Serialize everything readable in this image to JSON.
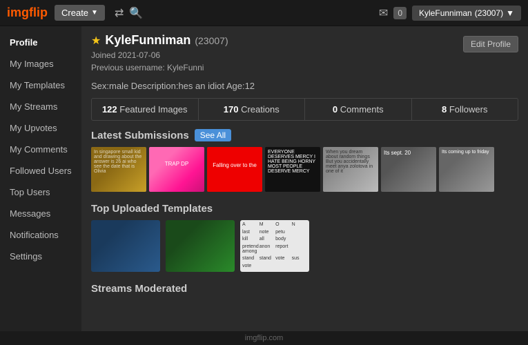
{
  "header": {
    "logo": "imgflip",
    "create_label": "Create",
    "mail_count": "0",
    "username": "KyleFunniman",
    "user_points": "(23007)",
    "user_menu_arrow": "▼"
  },
  "sidebar": {
    "items": [
      {
        "id": "profile",
        "label": "Profile",
        "active": true
      },
      {
        "id": "my-images",
        "label": "My Images"
      },
      {
        "id": "my-templates",
        "label": "My Templates"
      },
      {
        "id": "my-streams",
        "label": "My Streams"
      },
      {
        "id": "my-upvotes",
        "label": "My Upvotes"
      },
      {
        "id": "my-comments",
        "label": "My Comments"
      },
      {
        "id": "followed-users",
        "label": "Followed Users"
      },
      {
        "id": "top-users",
        "label": "Top Users"
      },
      {
        "id": "messages",
        "label": "Messages"
      },
      {
        "id": "notifications",
        "label": "Notifications"
      },
      {
        "id": "settings",
        "label": "Settings"
      }
    ]
  },
  "profile": {
    "star": "★",
    "username": "KyleFunniman",
    "points": "(23007)",
    "joined": "Joined 2021-07-06",
    "previous_username": "Previous username: KyleFunni",
    "description": "Sex:male Description:hes an idiot Age:12",
    "edit_label": "Edit Profile",
    "stats": [
      {
        "count": "122",
        "label": "Featured Images"
      },
      {
        "count": "170",
        "label": "Creations"
      },
      {
        "count": "0",
        "label": "Comments"
      },
      {
        "count": "8",
        "label": "Followers"
      }
    ],
    "latest_submissions_title": "Latest Submissions",
    "see_all_label": "See All",
    "top_templates_title": "Top Uploaded Templates",
    "streams_moderated_title": "Streams Moderated"
  },
  "footer": {
    "text": "imgflip.com"
  }
}
